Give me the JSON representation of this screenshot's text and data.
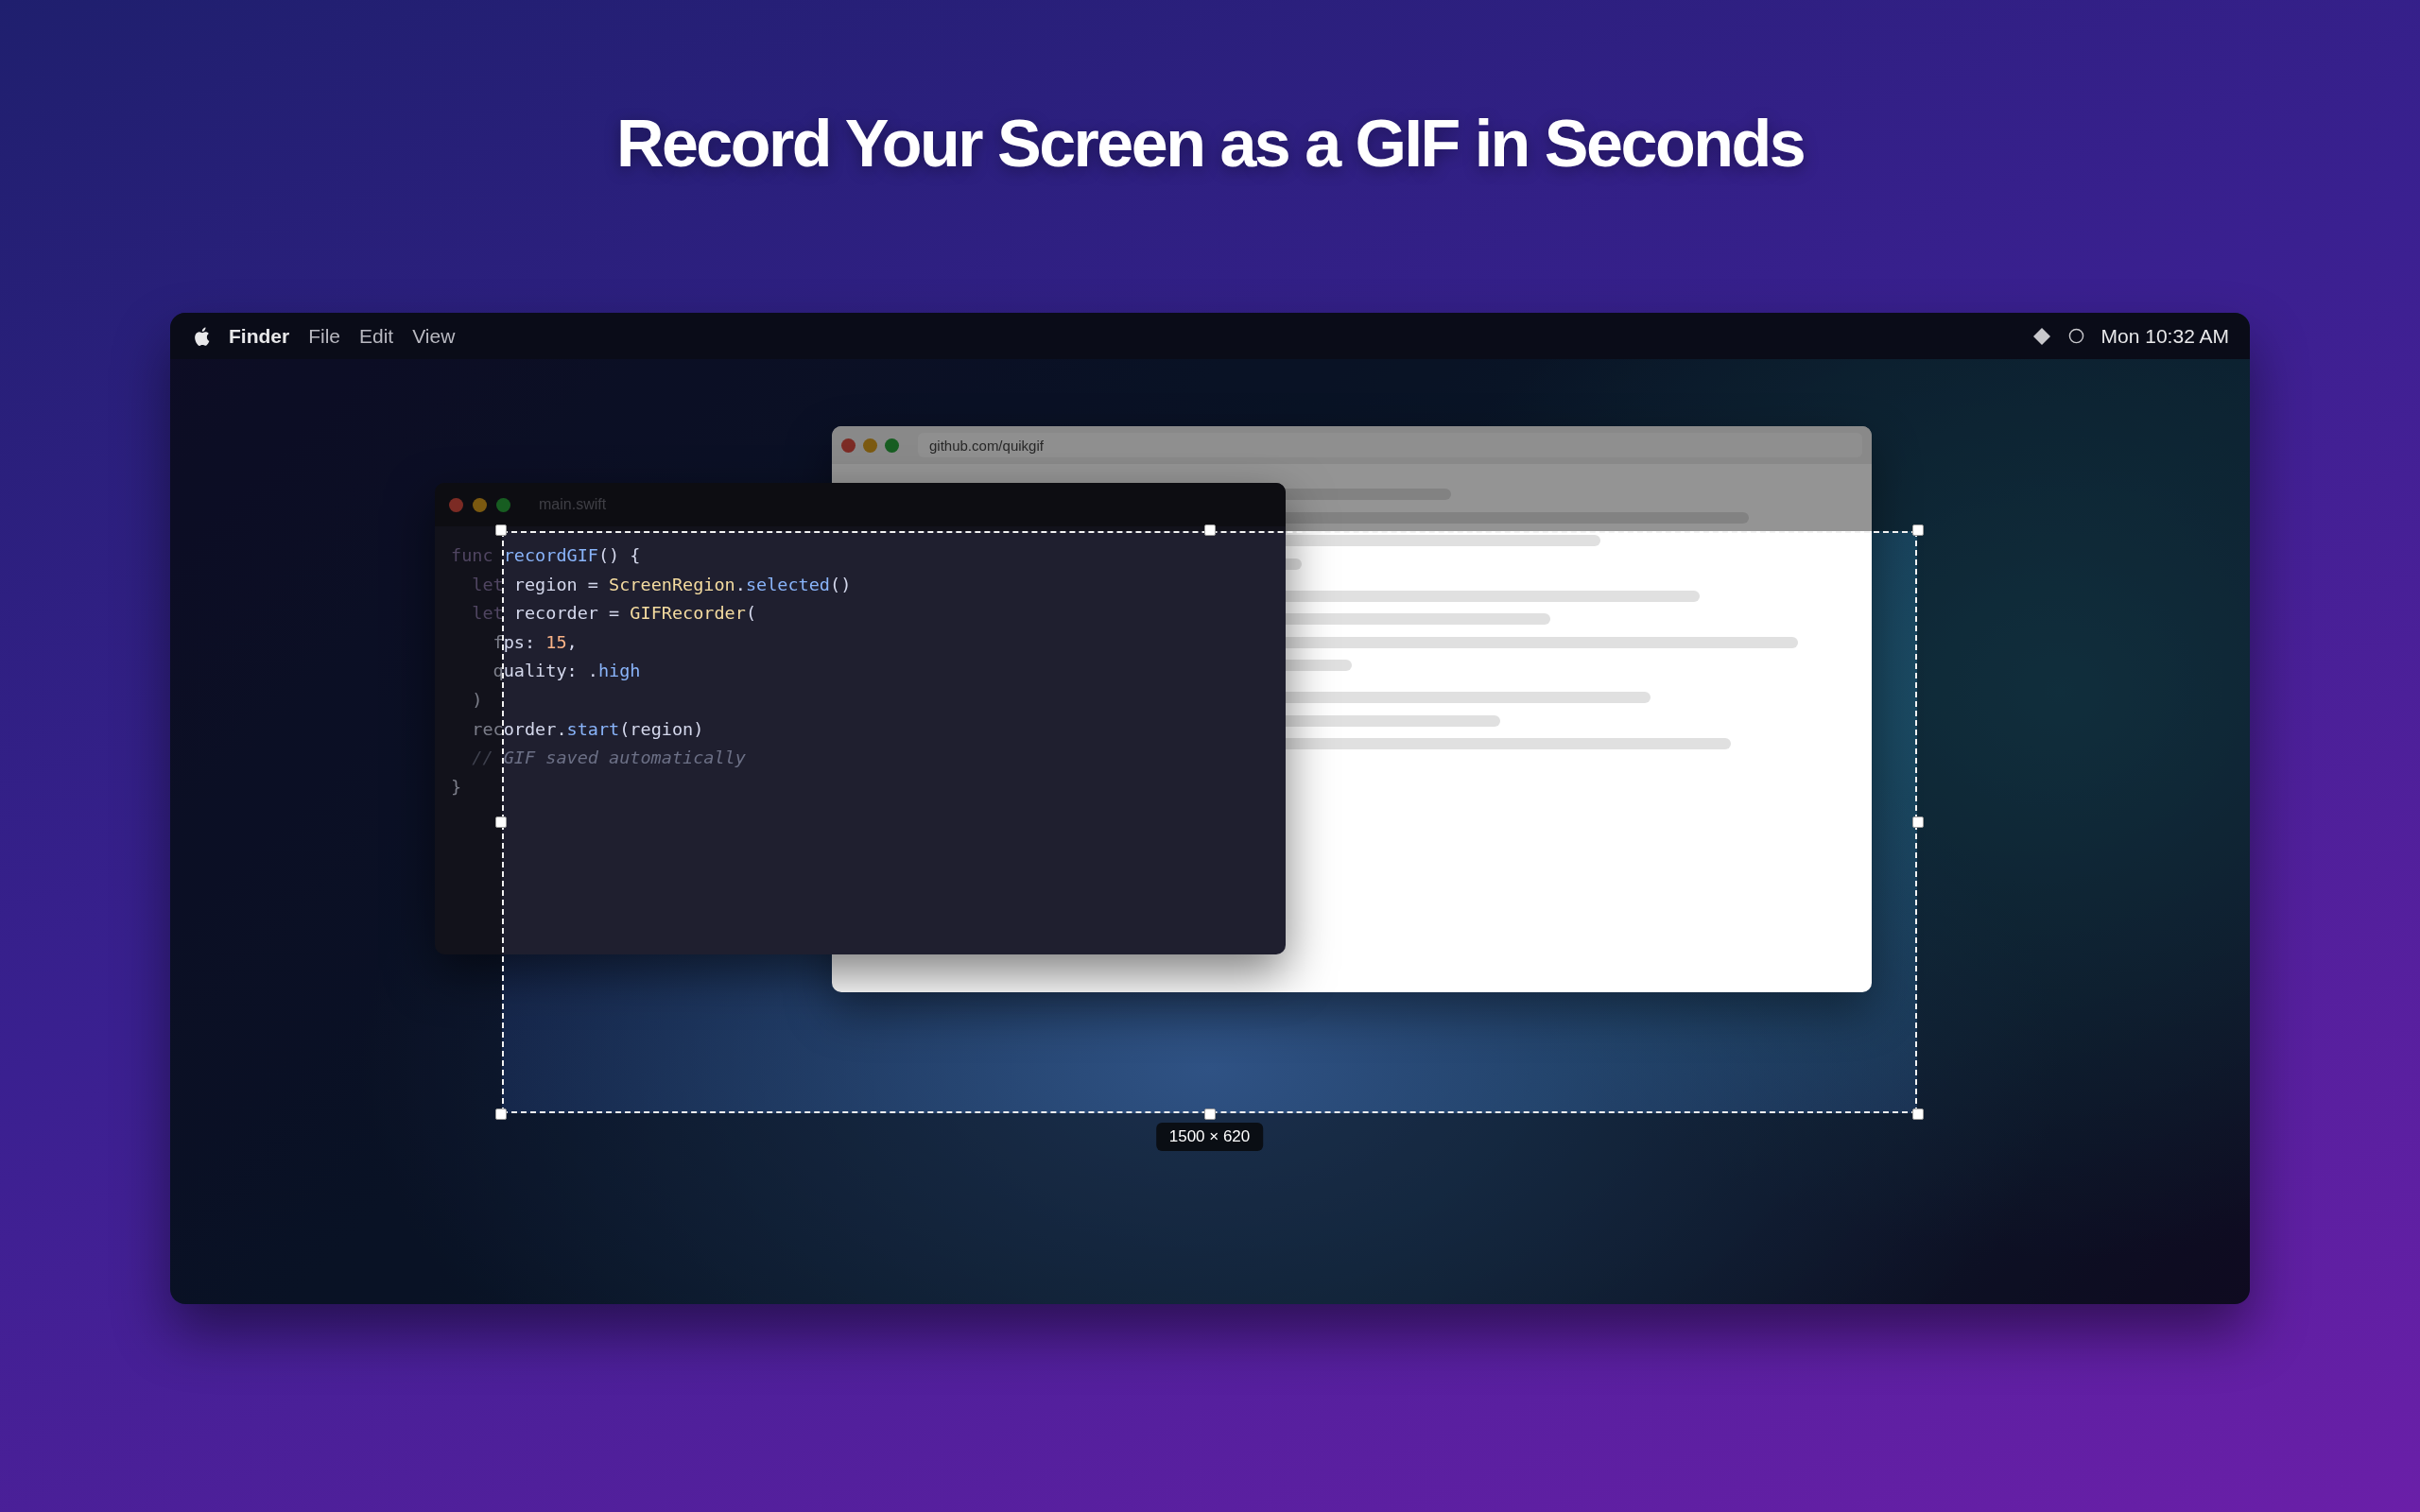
{
  "headline": "Record Your Screen as a GIF in Seconds",
  "menubar": {
    "app": "Finder",
    "menus": [
      "File",
      "Edit",
      "View"
    ],
    "clock": "Mon 10:32 AM"
  },
  "browser": {
    "url": "github.com/quikgif"
  },
  "editor": {
    "filename": "main.swift",
    "lines": [
      [
        {
          "kind": "keyword",
          "text": "func "
        },
        {
          "kind": "function",
          "text": "recordGIF"
        },
        {
          "kind": "plain",
          "text": "() {"
        }
      ],
      [
        {
          "kind": "keyword",
          "text": "  let"
        },
        {
          "kind": "plain",
          "text": " region = "
        },
        {
          "kind": "type",
          "text": "ScreenRegion"
        },
        {
          "kind": "plain",
          "text": "."
        },
        {
          "kind": "function",
          "text": "selected"
        },
        {
          "kind": "plain",
          "text": "()"
        }
      ],
      [
        {
          "kind": "keyword",
          "text": "  let"
        },
        {
          "kind": "plain",
          "text": " recorder = "
        },
        {
          "kind": "type",
          "text": "GIFRecorder"
        },
        {
          "kind": "plain",
          "text": "("
        }
      ],
      [
        {
          "kind": "plain",
          "text": "    fps: "
        },
        {
          "kind": "number",
          "text": "15"
        },
        {
          "kind": "plain",
          "text": ","
        }
      ],
      [
        {
          "kind": "plain",
          "text": "    quality: ."
        },
        {
          "kind": "function",
          "text": "high"
        }
      ],
      [
        {
          "kind": "plain",
          "text": "  )"
        }
      ],
      [
        {
          "kind": "plain",
          "text": "  recorder."
        },
        {
          "kind": "function",
          "text": "start"
        },
        {
          "kind": "plain",
          "text": "(region)"
        }
      ],
      [
        {
          "kind": "comment",
          "text": "  // GIF saved automatically"
        }
      ],
      [
        {
          "kind": "plain",
          "text": "}"
        }
      ]
    ]
  },
  "selection": {
    "size_label": "1500 × 620"
  }
}
